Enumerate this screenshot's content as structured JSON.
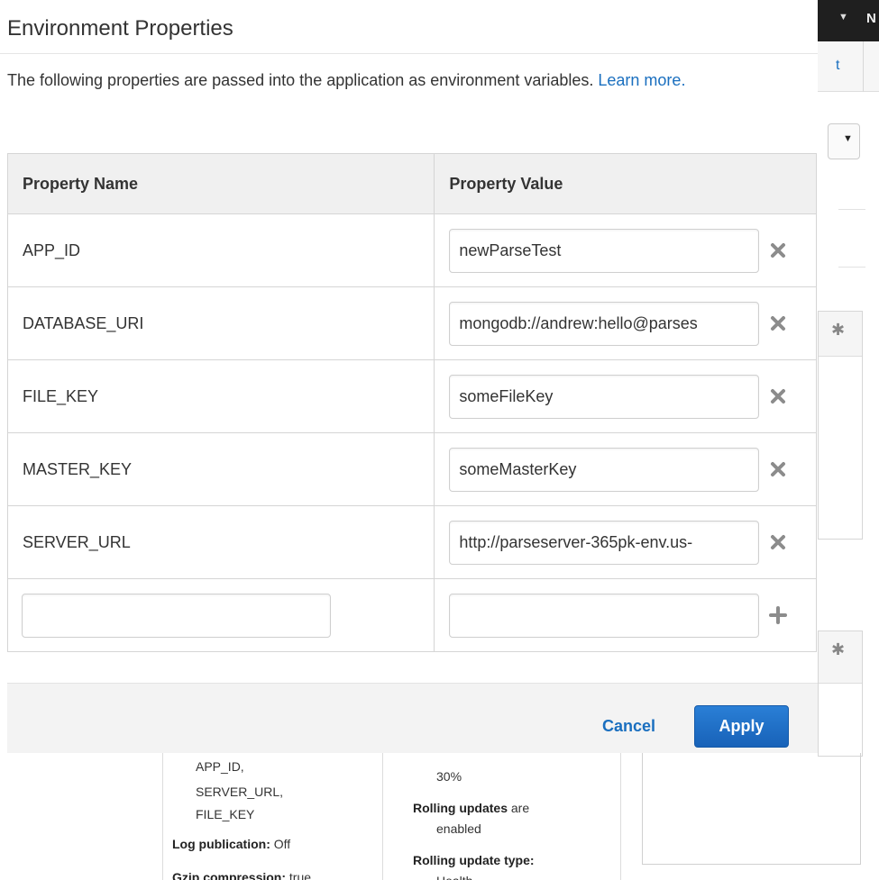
{
  "modal": {
    "title": "Environment Properties",
    "intro_text": "The following properties are passed into the application as environment variables.",
    "learn_more": "Learn more.",
    "columns": {
      "name": "Property Name",
      "value": "Property Value"
    },
    "rows": [
      {
        "name": "APP_ID",
        "value": "newParseTest"
      },
      {
        "name": "DATABASE_URI",
        "value": "mongodb://andrew:hello@parses"
      },
      {
        "name": "FILE_KEY",
        "value": "someFileKey"
      },
      {
        "name": "MASTER_KEY",
        "value": "someMasterKey"
      },
      {
        "name": "SERVER_URL",
        "value": "http://parseserver-365pk-env.us-"
      }
    ],
    "new_row": {
      "name": "",
      "value": ""
    },
    "cancel_label": "Cancel",
    "apply_label": "Apply"
  },
  "background": {
    "top_bar_letter": "N",
    "tab_fragment": "t",
    "config_col1": {
      "line1": "APP_ID,",
      "line2": "SERVER_URL,",
      "line3": "FILE_KEY",
      "log_label": "Log publication:",
      "log_value": "Off",
      "gzip_label": "Gzip compression:",
      "gzip_value": "true"
    },
    "config_col2": {
      "line1": "30%",
      "rolling_label": "Rolling updates",
      "rolling_value": "are",
      "rolling_line2": "enabled",
      "rolling_type_label": "Rolling update type:",
      "rolling_type_value": "Health"
    }
  },
  "colors": {
    "link": "#1a6fbf",
    "primary_button": "#1f6fc5",
    "header_bg": "#f0f0f0"
  },
  "icons": {
    "remove": "remove-x-icon",
    "add": "add-plus-icon",
    "caret": "caret-down-icon",
    "gear": "gear-icon"
  }
}
